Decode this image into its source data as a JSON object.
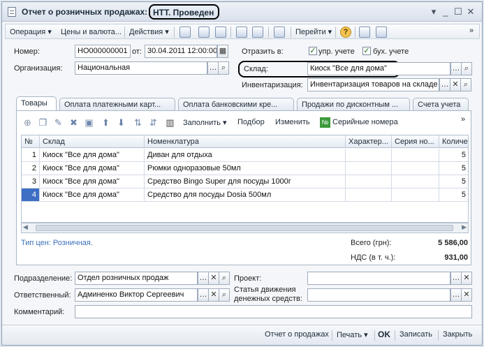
{
  "window": {
    "title": "Отчет о розничных продажах:",
    "status": "НТТ. Проведен"
  },
  "toolbar": {
    "operation": "Операция ▾",
    "prices_currency": "Цены и валюта...",
    "actions": "Действия ▾",
    "goto": "Перейти ▾"
  },
  "header": {
    "number_label": "Номер:",
    "number_value": "НО000000001",
    "from_label": "от:",
    "date_value": "30.04.2011 12:00:00",
    "org_label": "Организация:",
    "org_value": "Национальная",
    "reflect_label": "Отразить в:",
    "mgmt_label": "упр. учете",
    "acct_label": "бух. учете",
    "warehouse_label": "Склад:",
    "warehouse_value": "Киоск \"Все для дома\"",
    "inventory_label": "Инвентаризация:",
    "inventory_value": "Инвентаризация товаров на складе"
  },
  "tabs": [
    {
      "label": "Товары"
    },
    {
      "label": "Оплата платежными карт..."
    },
    {
      "label": "Оплата банковскими кре..."
    },
    {
      "label": "Продажи по дисконтным ..."
    },
    {
      "label": "Счета учета"
    }
  ],
  "subtoolbar": {
    "fill": "Заполнить ▾",
    "select": "Подбор",
    "change": "Изменить",
    "serials": "Серийные номера"
  },
  "table": {
    "columns": [
      "№",
      "Склад",
      "Номенклатура",
      "Характер...",
      "Серия но...",
      "Количе"
    ],
    "rows": [
      {
        "n": "1",
        "warehouse": "Киоск \"Все для дома\"",
        "item": "Диван для отдыха",
        "char": "",
        "series": "",
        "qty": "5"
      },
      {
        "n": "2",
        "warehouse": "Киоск \"Все для дома\"",
        "item": "Рюмки одноразовые 50мл",
        "char": "",
        "series": "",
        "qty": "5"
      },
      {
        "n": "3",
        "warehouse": "Киоск \"Все для дома\"",
        "item": "Средство Bingo Super для посуды 1000г",
        "char": "",
        "series": "",
        "qty": "5"
      },
      {
        "n": "4",
        "warehouse": "Киоск \"Все для дома\"",
        "item": "Средство для посуды Dosia 500мл",
        "char": "",
        "series": "",
        "qty": "5"
      }
    ]
  },
  "totals": {
    "price_type": "Тип цен: Розничная.",
    "total_label": "Всего (грн):",
    "total_value": "5 586,00",
    "vat_label": "НДС (в т. ч.):",
    "vat_value": "931,00"
  },
  "bottom": {
    "dept_label": "Подразделение:",
    "dept_value": "Отдел розничных продаж",
    "resp_label": "Ответственный:",
    "resp_value": "Админенко Виктор Сергеевич",
    "project_label": "Проект:",
    "project_value": "",
    "cashflow_label_1": "Статья движения",
    "cashflow_label_2": "денежных средств:",
    "cashflow_value": "",
    "comment_label": "Комментарий:",
    "comment_value": ""
  },
  "footer": {
    "report": "Отчет о продажах",
    "print": "Печать ▾",
    "ok": "OK",
    "save": "Записать",
    "close": "Закрыть"
  }
}
